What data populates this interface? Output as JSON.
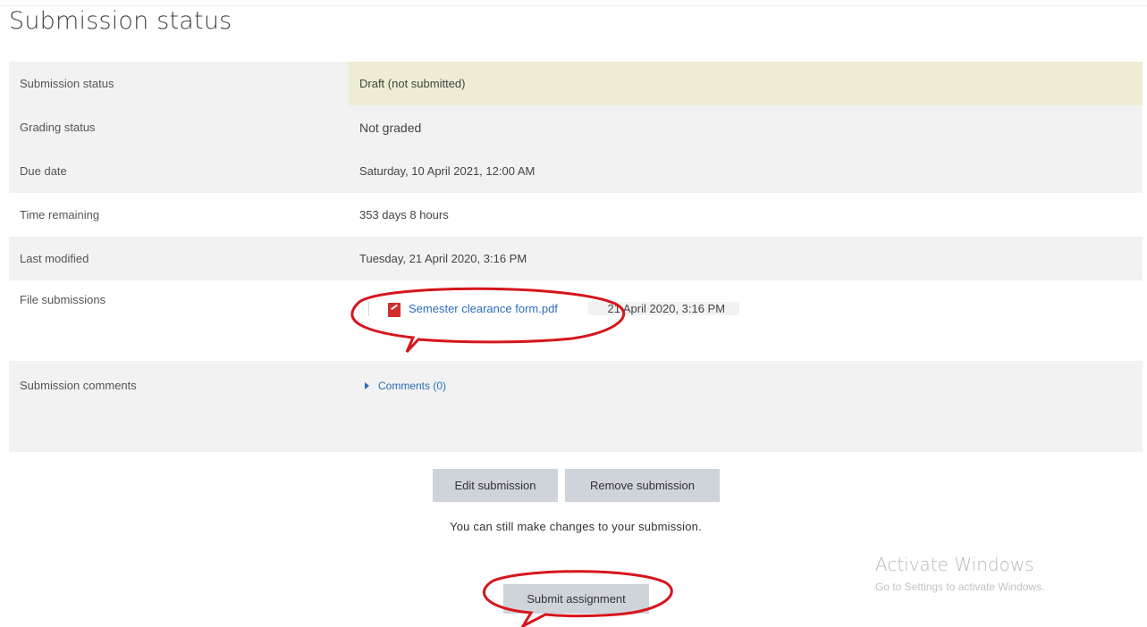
{
  "page": {
    "heading": "Submission status"
  },
  "status_table": {
    "rows": [
      {
        "label": "Submission status",
        "value": "Draft (not submitted)"
      },
      {
        "label": "Grading status",
        "value": "Not graded"
      },
      {
        "label": "Due date",
        "value": "Saturday, 10 April 2021, 12:00 AM"
      },
      {
        "label": "Time remaining",
        "value": "353 days 8 hours"
      },
      {
        "label": "Last modified",
        "value": "Tuesday, 21 April 2020, 3:16 PM"
      },
      {
        "label": "File submissions",
        "file_name": "Semester clearance form.pdf",
        "file_date": "21 April 2020, 3:16 PM",
        "file_icon": "pdf-file-icon"
      },
      {
        "label": "Submission comments",
        "comments_link": "Comments (0)",
        "toggle_icon": "caret-right-icon"
      }
    ]
  },
  "actions": {
    "edit_label": "Edit submission",
    "remove_label": "Remove submission",
    "note": "You can still make changes to your submission.",
    "submit_label": "Submit assignment"
  },
  "windows_watermark": {
    "title": "Activate Windows",
    "subtitle": "Go to Settings to activate Windows."
  },
  "colors": {
    "draft_bg": "#eeecd3",
    "row_alt_bg": "#f2f2f2",
    "link": "#2a6ebb",
    "button_bg": "#ced4da",
    "annotation_red": "#d6161d"
  }
}
